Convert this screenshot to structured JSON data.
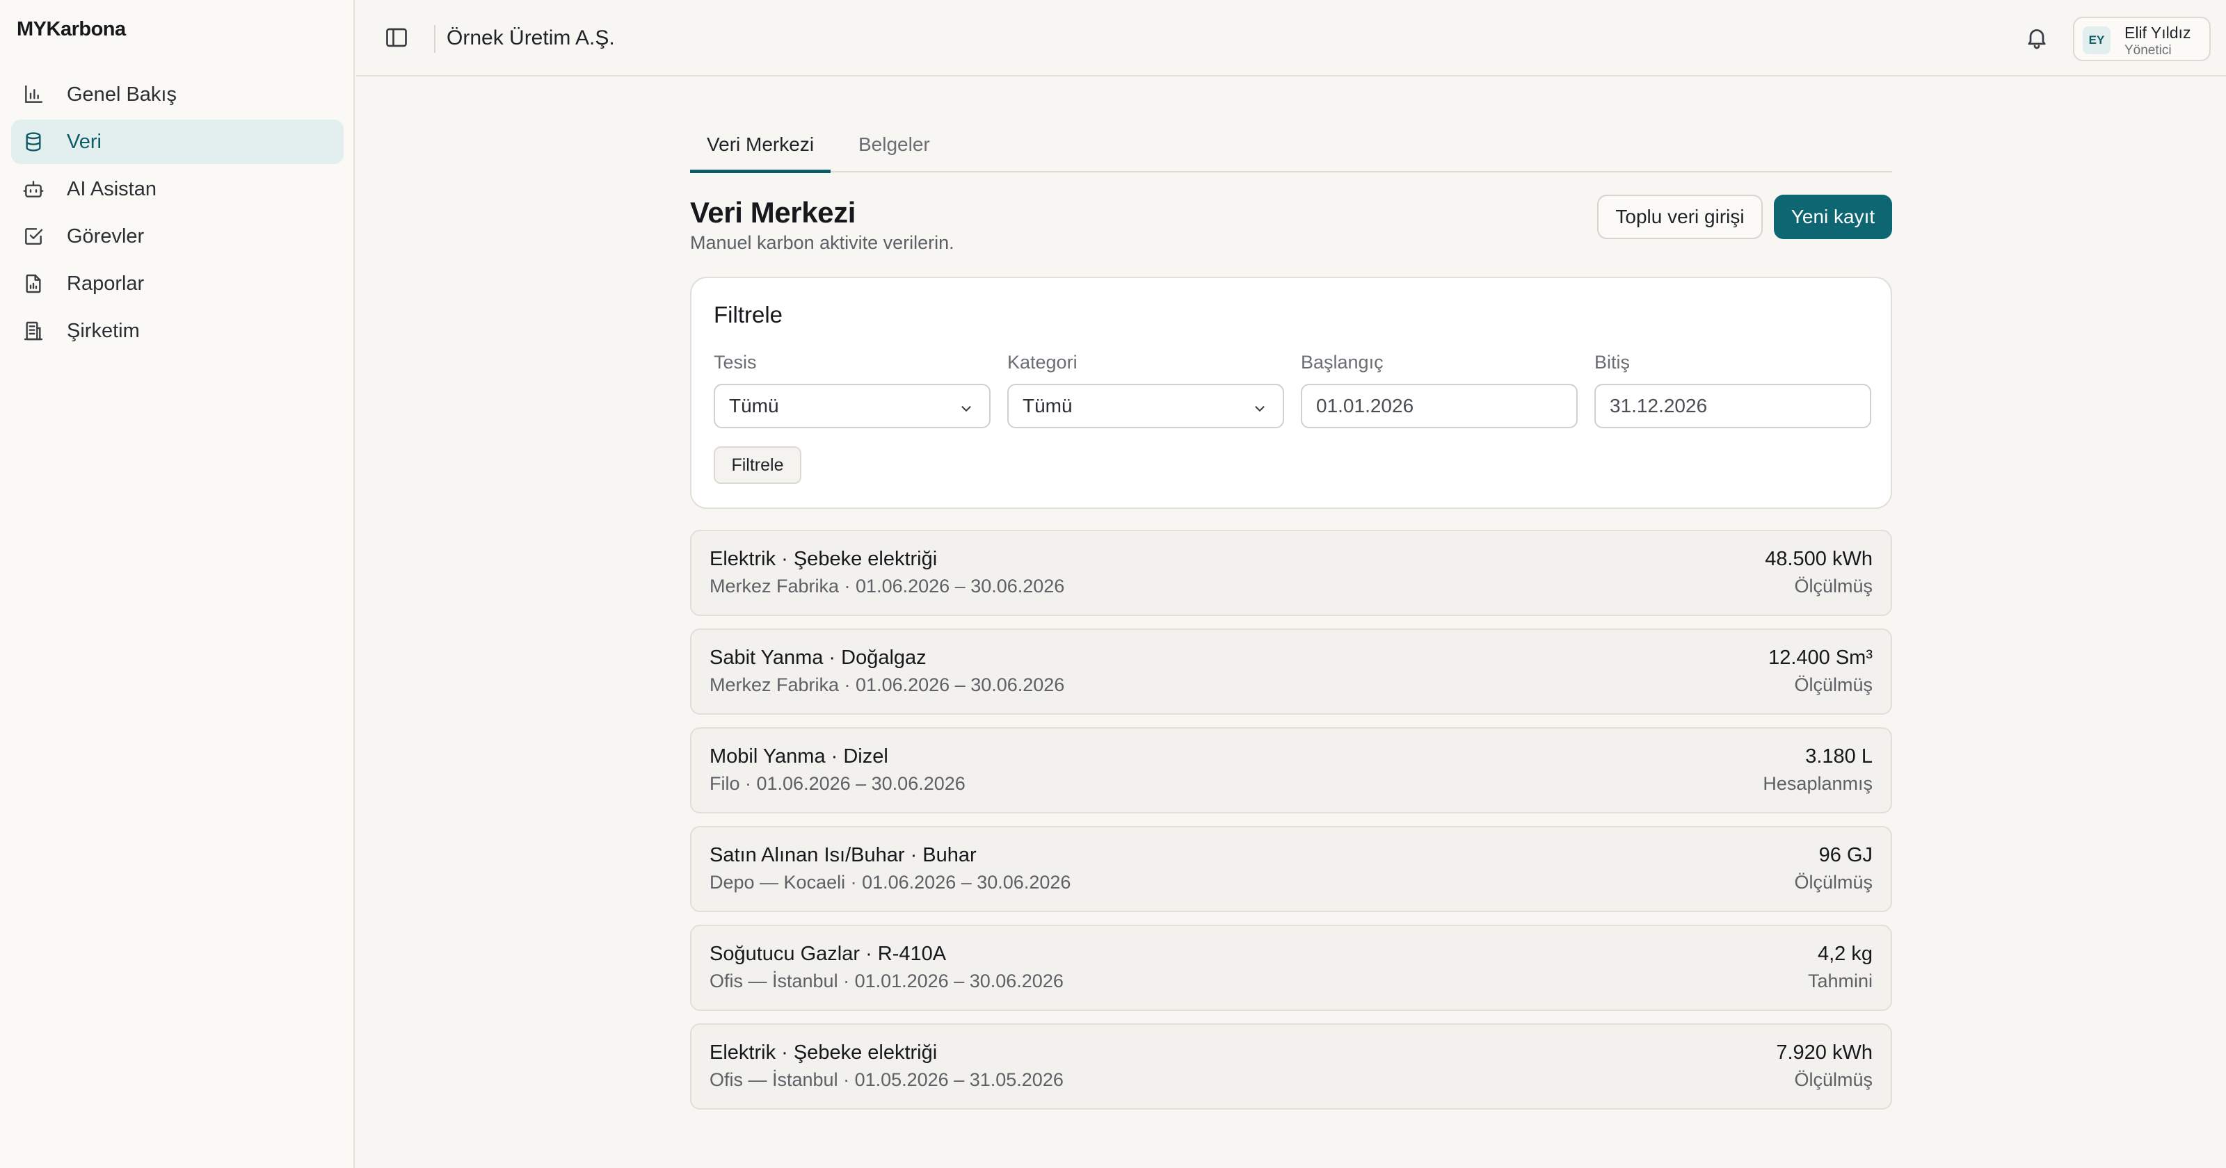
{
  "app": {
    "brand": "MYKarbona"
  },
  "sidebar": {
    "items": [
      {
        "label": "Genel Bakış",
        "icon": "bar-chart-icon"
      },
      {
        "label": "Veri",
        "icon": "database-icon",
        "active": true
      },
      {
        "label": "AI Asistan",
        "icon": "bot-icon"
      },
      {
        "label": "Görevler",
        "icon": "check-square-icon"
      },
      {
        "label": "Raporlar",
        "icon": "report-file-icon"
      },
      {
        "label": "Şirketim",
        "icon": "building-icon"
      }
    ]
  },
  "header": {
    "company": "Örnek Üretim A.Ş.",
    "user": {
      "initials": "EY",
      "name": "Elif Yıldız",
      "role": "Yönetici"
    }
  },
  "main": {
    "tabs": [
      {
        "label": "Veri Merkezi",
        "active": true
      },
      {
        "label": "Belgeler",
        "active": false
      }
    ],
    "title": "Veri Merkezi",
    "subtitle": "Manuel karbon aktivite verilerin.",
    "actions": {
      "bulk_entry": "Toplu veri girişi",
      "new_record": "Yeni kayıt"
    },
    "filter": {
      "title": "Filtrele",
      "facility": {
        "label": "Tesis",
        "value": "Tümü"
      },
      "category": {
        "label": "Kategori",
        "value": "Tümü"
      },
      "start": {
        "label": "Başlangıç",
        "value": "01.01.2026"
      },
      "end": {
        "label": "Bitiş",
        "value": "31.12.2026"
      },
      "submit": "Filtrele"
    },
    "records": [
      {
        "title": "Elektrik · Şebeke elektriği",
        "meta": "Merkez Fabrika · 01.06.2026 – 30.06.2026",
        "amount": "48.500 kWh",
        "status": "Ölçülmüş"
      },
      {
        "title": "Sabit Yanma · Doğalgaz",
        "meta": "Merkez Fabrika · 01.06.2026 – 30.06.2026",
        "amount": "12.400 Sm³",
        "status": "Ölçülmüş"
      },
      {
        "title": "Mobil Yanma · Dizel",
        "meta": "Filo · 01.06.2026 – 30.06.2026",
        "amount": "3.180 L",
        "status": "Hesaplanmış"
      },
      {
        "title": "Satın Alınan Isı/Buhar · Buhar",
        "meta": "Depo — Kocaeli · 01.06.2026 – 30.06.2026",
        "amount": "96 GJ",
        "status": "Ölçülmüş"
      },
      {
        "title": "Soğutucu Gazlar · R-410A",
        "meta": "Ofis — İstanbul · 01.01.2026 – 30.06.2026",
        "amount": "4,2 kg",
        "status": "Tahmini"
      },
      {
        "title": "Elektrik · Şebeke elektriği",
        "meta": "Ofis — İstanbul · 01.05.2026 – 31.05.2026",
        "amount": "7.920 kWh",
        "status": "Ölçülmüş"
      }
    ]
  },
  "colors": {
    "accent": "#0e6672",
    "active_nav_bg": "#e3eeee",
    "page_bg": "#f7f6f2"
  }
}
